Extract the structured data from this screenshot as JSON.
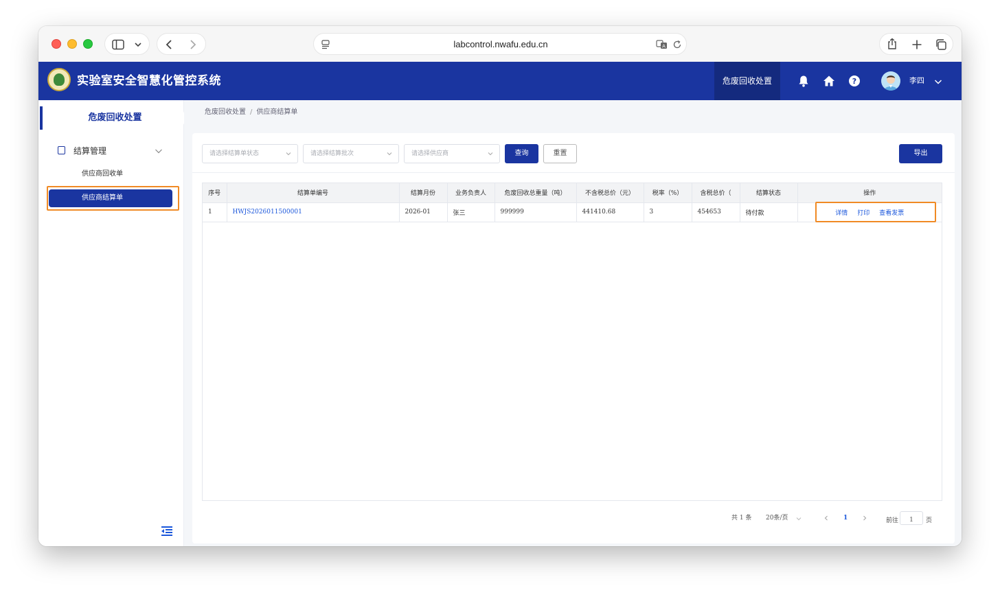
{
  "browser": {
    "url": "labcontrol.nwafu.edu.cn"
  },
  "header": {
    "title": "实验室安全智慧化管控系统",
    "active_module": "危废回收处置",
    "user_name": "李四"
  },
  "sidebar": {
    "heading": "危废回收处置",
    "group_label": "结算管理",
    "items": [
      {
        "label": "供应商回收单",
        "active": false
      },
      {
        "label": "供应商结算单",
        "active": true
      }
    ]
  },
  "breadcrumb": {
    "items": [
      "危废回收处置",
      "供应商结算单"
    ],
    "separator": "/"
  },
  "filters": {
    "status_placeholder": "请选择结算单状态",
    "batch_placeholder": "请选择结算批次",
    "supplier_placeholder": "请选择供应商",
    "query_label": "查询",
    "reset_label": "重置",
    "export_label": "导出"
  },
  "table": {
    "columns": [
      "序号",
      "结算单编号",
      "结算月份",
      "业务负责人",
      "危废回收总重量（吨）",
      "不含税总价（元）",
      "税率（%）",
      "含税总价（",
      "结算状态",
      "操作"
    ],
    "rows": [
      {
        "index": "1",
        "code": "HWJS2026011500001",
        "month": "2026-01",
        "owner": "张三",
        "weight": "999999",
        "price_ex_tax": "441410.68",
        "tax_rate": "3",
        "price_inc_tax": "454653",
        "status": "待付款",
        "actions": [
          "详情",
          "打印",
          "查看发票"
        ]
      }
    ]
  },
  "pagination": {
    "total_text": "共 1 条",
    "page_size": "20条/页",
    "current_page": "1",
    "goto_prefix": "前往",
    "goto_value": "1",
    "goto_suffix": "页"
  },
  "colors": {
    "brand": "#1a35a0",
    "highlight": "#f08a24",
    "link": "#1a56db"
  }
}
